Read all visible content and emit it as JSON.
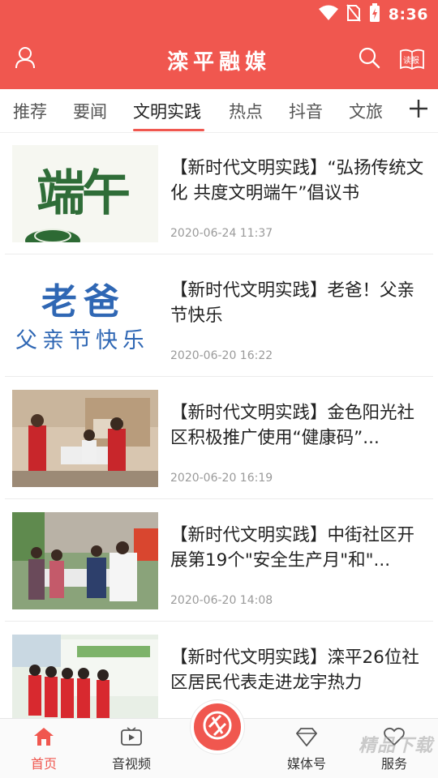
{
  "status": {
    "time": "8:36"
  },
  "header": {
    "title": "滦平融媒",
    "read_label": "读报"
  },
  "tabs": [
    "推荐",
    "要闻",
    "文明实践",
    "热点",
    "抖音",
    "文旅"
  ],
  "active_tab": "文明实践",
  "articles": [
    {
      "title": "【新时代文明实践】“弘扬传统文化 共度文明端午”倡议书",
      "date": "2020-06-24 11:37",
      "thumb_text": "端午"
    },
    {
      "title": "【新时代文明实践】老爸！父亲节快乐",
      "date": "2020-06-20 16:22",
      "thumb_text": "老爸",
      "thumb_sub": "父亲节快乐"
    },
    {
      "title": "【新时代文明实践】金色阳光社区积极推广使用“健康码”...",
      "date": "2020-06-20 16:19"
    },
    {
      "title": "【新时代文明实践】中街社区开展第19个\"安全生产月\"和\"...",
      "date": "2020-06-20 14:08"
    },
    {
      "title": "【新时代文明实践】滦平26位社区居民代表走进龙宇热力",
      "date": ""
    }
  ],
  "bottom_nav": [
    {
      "label": "首页",
      "icon": "home-icon"
    },
    {
      "label": "音视频",
      "icon": "tv-icon"
    },
    {
      "label": "媒体号",
      "icon": "diamond-icon"
    },
    {
      "label": "服务",
      "icon": "service-icon"
    }
  ],
  "watermark": "精品下载",
  "colors": {
    "brand": "#f0574f"
  }
}
